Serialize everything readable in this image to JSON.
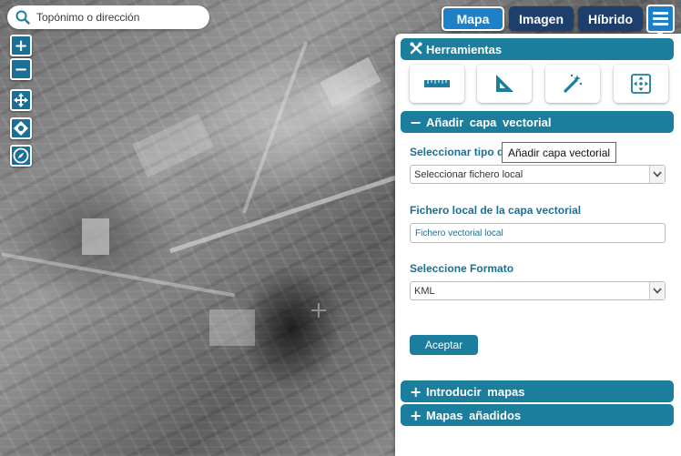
{
  "search": {
    "placeholder": "Topónimo o dirección",
    "icon": "search-icon"
  },
  "map_controls": {
    "zoom_in": "+",
    "zoom_out": "−"
  },
  "base_layers": {
    "map": "Mapa",
    "image": "Imagen",
    "hybrid": "Híbrido",
    "active": "Mapa"
  },
  "panel": {
    "tools": {
      "title": "Herramientas",
      "sign": "✖"
    },
    "add_vector": {
      "title": "Añadir capa vectorial",
      "sign": "−",
      "type_label": "Seleccionar tipo de",
      "type_value": "Seleccionar fichero local",
      "file_label": "Fichero local de la capa vectorial",
      "file_placeholder": "Fichero vectorial local",
      "format_label": "Seleccione Formato",
      "format_value": "KML",
      "accept_label": "Aceptar"
    },
    "introduce_maps": {
      "title": "Introducir mapas",
      "sign": "+"
    },
    "added_maps": {
      "title": "Mapas añadidos",
      "sign": "+"
    }
  },
  "tooltip": {
    "text": "Añadir capa vectorial"
  },
  "colors": {
    "accent": "#1c7e9d",
    "active_tab": "#1f80c8",
    "inactive_tab": "#1d3f6e"
  }
}
